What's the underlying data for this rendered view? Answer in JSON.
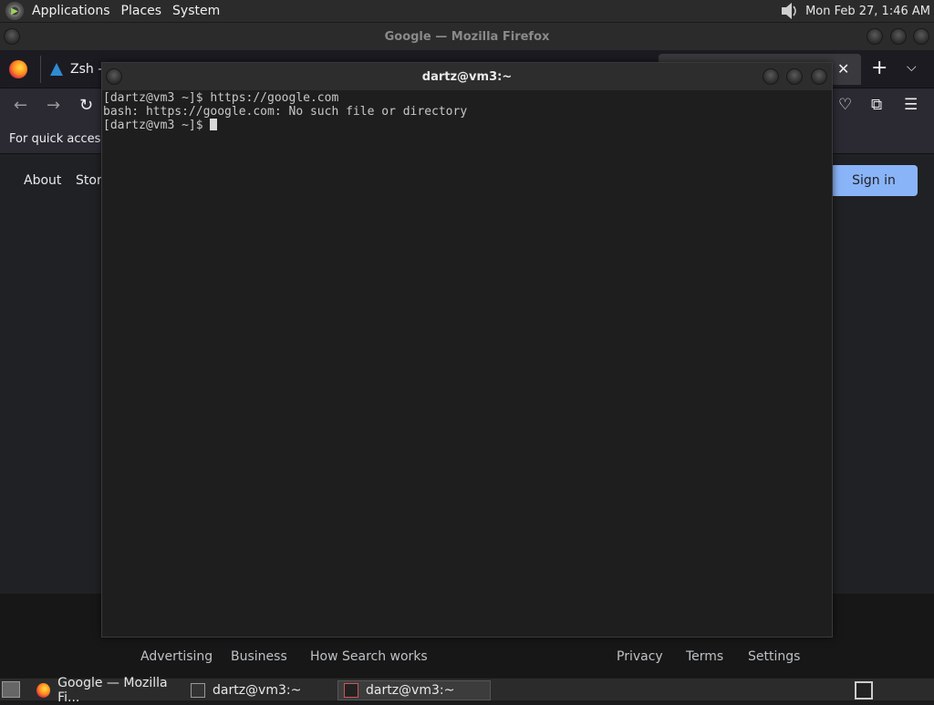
{
  "top_panel": {
    "menus": [
      "Applications",
      "Places",
      "System"
    ],
    "clock": "Mon Feb 27, 1:46 AM"
  },
  "firefox": {
    "window_title": "Google — Mozilla Firefox",
    "tab_label": "Zsh -",
    "bookmarks_text": "For quick access,",
    "google": {
      "about": "About",
      "store": "Store",
      "signin": "Sign in",
      "footer_left": [
        "Advertising",
        "Business",
        "How Search works"
      ],
      "footer_right": [
        "Privacy",
        "Terms",
        "Settings"
      ]
    }
  },
  "terminal": {
    "title": "dartz@vm3:~",
    "lines": [
      "[dartz@vm3 ~]$ https://google.com",
      "bash: https://google.com: No such file or directory",
      "[dartz@vm3 ~]$ "
    ]
  },
  "taskbar": {
    "tasks": [
      "Google — Mozilla Fi...",
      "dartz@vm3:~",
      "dartz@vm3:~"
    ]
  }
}
